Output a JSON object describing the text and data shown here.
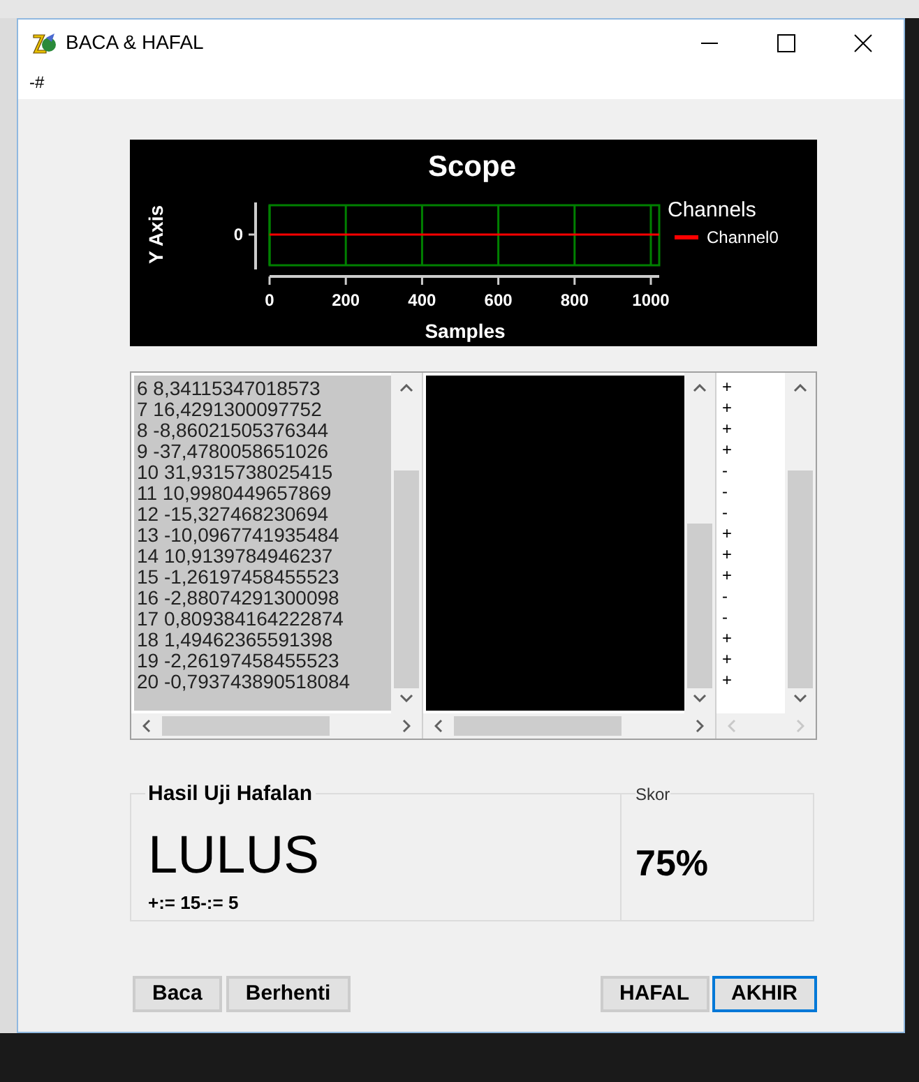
{
  "window": {
    "title": "BACA & HAFAL"
  },
  "menu": [
    "-#"
  ],
  "scope": {
    "title": "Scope",
    "y_label": "Y Axis",
    "y_tick": "0",
    "x_ticks": [
      "0",
      "200",
      "400",
      "600",
      "800",
      "1000"
    ],
    "x_label": "Samples",
    "legend_title": "Channels",
    "legend_item": "Channel0"
  },
  "data_list": [
    "6 8,34115347018573",
    "7 16,4291300097752",
    "8 -8,86021505376344",
    "9 -37,4780058651026",
    "10 31,9315738025415",
    "11 10,9980449657869",
    "12 -15,327468230694",
    "13 -10,0967741935484",
    "14 10,9139784946237",
    "15 -1,26197458455523",
    "16 -2,88074291300098",
    "17 0,809384164222874",
    "18 1,49462365591398",
    "19 -2,26197458455523",
    "20 -0,793743890518084"
  ],
  "sign_list": [
    "+",
    "+",
    "+",
    "+",
    "-",
    "-",
    "-",
    "+",
    "+",
    "+",
    "-",
    "-",
    "+",
    "+",
    "+"
  ],
  "result": {
    "title": "Hasil Uji Hafalan",
    "verdict": "LULUS",
    "counts": "+:= 15-:= 5"
  },
  "score": {
    "title": "Skor",
    "value": "75%"
  },
  "buttons_left": [
    {
      "label": "Baca",
      "focused": false
    },
    {
      "label": "Berhenti",
      "focused": false
    }
  ],
  "buttons_right": [
    {
      "label": "HAFAL",
      "focused": false
    },
    {
      "label": "AKHIR",
      "focused": true
    }
  ]
}
